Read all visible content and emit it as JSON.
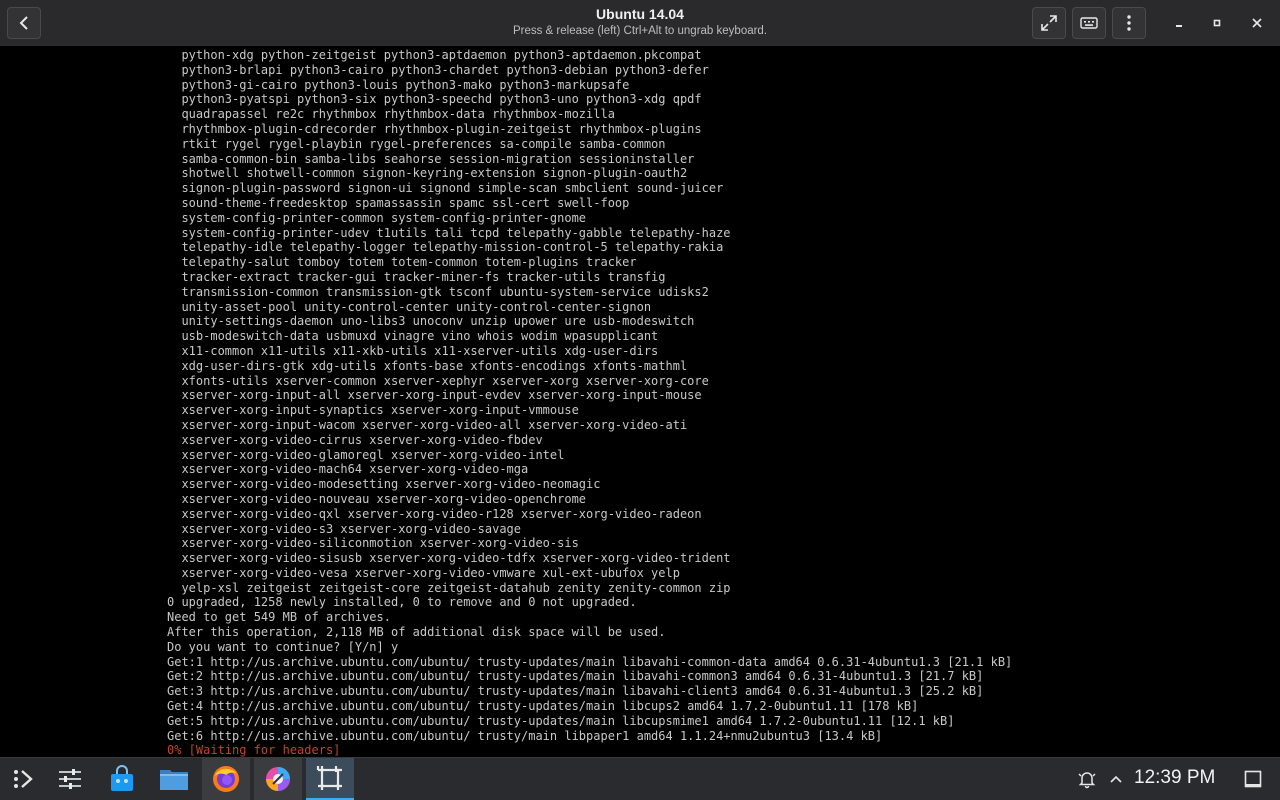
{
  "window": {
    "title": "Ubuntu 14.04",
    "subtitle": "Press & release (left) Ctrl+Alt to ungrab keyboard."
  },
  "titlebar_icons": {
    "back": "back-arrow-icon",
    "fullscreen": "fullscreen-icon",
    "keyboard": "keyboard-icon",
    "menu": "kebab-menu-icon",
    "minimize": "minimize-icon",
    "maximize": "maximize-icon",
    "close": "close-icon"
  },
  "terminal": {
    "lines": [
      "  python-xdg python-zeitgeist python3-aptdaemon python3-aptdaemon.pkcompat",
      "  python3-brlapi python3-cairo python3-chardet python3-debian python3-defer",
      "  python3-gi-cairo python3-louis python3-mako python3-markupsafe",
      "  python3-pyatspi python3-six python3-speechd python3-uno python3-xdg qpdf",
      "  quadrapassel re2c rhythmbox rhythmbox-data rhythmbox-mozilla",
      "  rhythmbox-plugin-cdrecorder rhythmbox-plugin-zeitgeist rhythmbox-plugins",
      "  rtkit rygel rygel-playbin rygel-preferences sa-compile samba-common",
      "  samba-common-bin samba-libs seahorse session-migration sessioninstaller",
      "  shotwell shotwell-common signon-keyring-extension signon-plugin-oauth2",
      "  signon-plugin-password signon-ui signond simple-scan smbclient sound-juicer",
      "  sound-theme-freedesktop spamassassin spamc ssl-cert swell-foop",
      "  system-config-printer-common system-config-printer-gnome",
      "  system-config-printer-udev t1utils tali tcpd telepathy-gabble telepathy-haze",
      "  telepathy-idle telepathy-logger telepathy-mission-control-5 telepathy-rakia",
      "  telepathy-salut tomboy totem totem-common totem-plugins tracker",
      "  tracker-extract tracker-gui tracker-miner-fs tracker-utils transfig",
      "  transmission-common transmission-gtk tsconf ubuntu-system-service udisks2",
      "  unity-asset-pool unity-control-center unity-control-center-signon",
      "  unity-settings-daemon uno-libs3 unoconv unzip upower ure usb-modeswitch",
      "  usb-modeswitch-data usbmuxd vinagre vino whois wodim wpasupplicant",
      "  x11-common x11-utils x11-xkb-utils x11-xserver-utils xdg-user-dirs",
      "  xdg-user-dirs-gtk xdg-utils xfonts-base xfonts-encodings xfonts-mathml",
      "  xfonts-utils xserver-common xserver-xephyr xserver-xorg xserver-xorg-core",
      "  xserver-xorg-input-all xserver-xorg-input-evdev xserver-xorg-input-mouse",
      "  xserver-xorg-input-synaptics xserver-xorg-input-vmmouse",
      "  xserver-xorg-input-wacom xserver-xorg-video-all xserver-xorg-video-ati",
      "  xserver-xorg-video-cirrus xserver-xorg-video-fbdev",
      "  xserver-xorg-video-glamoregl xserver-xorg-video-intel",
      "  xserver-xorg-video-mach64 xserver-xorg-video-mga",
      "  xserver-xorg-video-modesetting xserver-xorg-video-neomagic",
      "  xserver-xorg-video-nouveau xserver-xorg-video-openchrome",
      "  xserver-xorg-video-qxl xserver-xorg-video-r128 xserver-xorg-video-radeon",
      "  xserver-xorg-video-s3 xserver-xorg-video-savage",
      "  xserver-xorg-video-siliconmotion xserver-xorg-video-sis",
      "  xserver-xorg-video-sisusb xserver-xorg-video-tdfx xserver-xorg-video-trident",
      "  xserver-xorg-video-vesa xserver-xorg-video-vmware xul-ext-ubufox yelp",
      "  yelp-xsl zeitgeist zeitgeist-core zeitgeist-datahub zenity zenity-common zip",
      "0 upgraded, 1258 newly installed, 0 to remove and 0 not upgraded.",
      "Need to get 549 MB of archives.",
      "After this operation, 2,118 MB of additional disk space will be used.",
      "Do you want to continue? [Y/n] y",
      "Get:1 http://us.archive.ubuntu.com/ubuntu/ trusty-updates/main libavahi-common-data amd64 0.6.31-4ubuntu1.3 [21.1 kB]",
      "Get:2 http://us.archive.ubuntu.com/ubuntu/ trusty-updates/main libavahi-common3 amd64 0.6.31-4ubuntu1.3 [21.7 kB]",
      "Get:3 http://us.archive.ubuntu.com/ubuntu/ trusty-updates/main libavahi-client3 amd64 0.6.31-4ubuntu1.3 [25.2 kB]",
      "Get:4 http://us.archive.ubuntu.com/ubuntu/ trusty-updates/main libcups2 amd64 1.7.2-0ubuntu1.11 [178 kB]",
      "Get:5 http://us.archive.ubuntu.com/ubuntu/ trusty-updates/main libcupsmime1 amd64 1.7.2-0ubuntu1.11 [12.1 kB]",
      "Get:6 http://us.archive.ubuntu.com/ubuntu/ trusty/main libpaper1 amd64 1.1.24+nmu2ubuntu3 [13.4 kB]"
    ],
    "progress_line": "0% [Waiting for headers]",
    "progress_color": "#c0452c"
  },
  "taskbar": {
    "items": [
      {
        "name": "app-launcher",
        "icon": "app-launcher-icon"
      },
      {
        "name": "settings",
        "icon": "sliders-icon"
      },
      {
        "name": "discover-store",
        "icon": "store-bag-icon"
      },
      {
        "name": "file-manager",
        "icon": "folder-icon"
      },
      {
        "name": "firefox",
        "icon": "firefox-icon"
      },
      {
        "name": "color-picker",
        "icon": "color-wheel-icon"
      },
      {
        "name": "virtual-machine",
        "icon": "vm-window-icon"
      }
    ],
    "tray": {
      "notifications_icon": "bell-icon",
      "expand_icon": "chevron-up-icon",
      "clock": "12:39 PM",
      "show_desktop_icon": "show-desktop-icon"
    },
    "accent_color": "#3daee9"
  }
}
